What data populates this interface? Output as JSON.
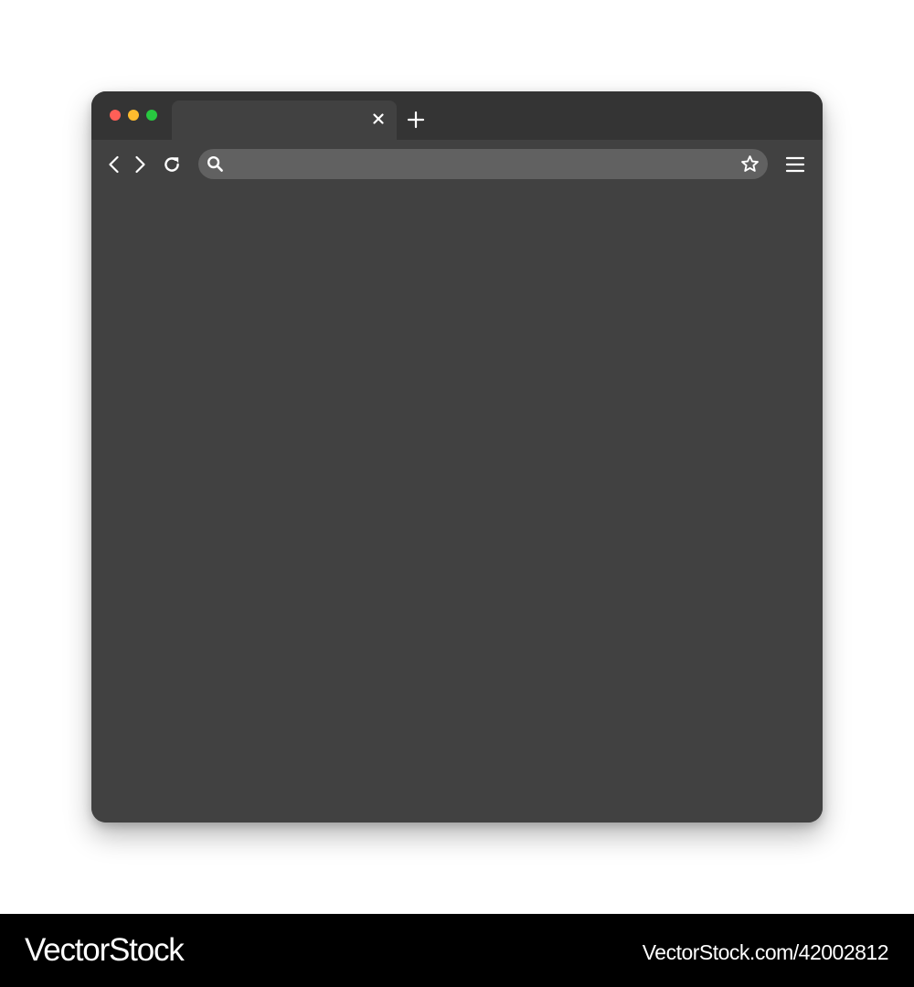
{
  "browser": {
    "tab": {
      "title": "",
      "close_icon": "close-icon"
    },
    "new_tab_icon": "plus-icon",
    "window_controls": {
      "close_color": "#ff5f57",
      "minimize_color": "#febc2e",
      "maximize_color": "#28c840"
    },
    "toolbar": {
      "back_icon": "chevron-left-icon",
      "forward_icon": "chevron-right-icon",
      "reload_icon": "reload-icon",
      "search_icon": "search-icon",
      "bookmark_icon": "star-icon",
      "menu_icon": "hamburger-menu-icon"
    },
    "address_bar": {
      "value": "",
      "placeholder": ""
    },
    "colors": {
      "tabbar": "#343434",
      "window": "#414141",
      "address_bar": "#616161",
      "icons": "#ffffff"
    }
  },
  "watermark": {
    "brand": "VectorStock",
    "image_ref": "VectorStock.com/42002812"
  }
}
